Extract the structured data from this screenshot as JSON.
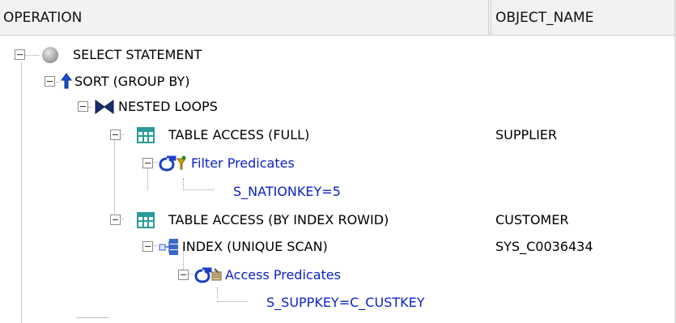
{
  "columns": {
    "operation": "OPERATION",
    "object_name": "OBJECT_NAME"
  },
  "rows": [
    {
      "label": "SELECT STATEMENT",
      "object": ""
    },
    {
      "label": "SORT (GROUP BY)",
      "object": ""
    },
    {
      "label": "NESTED LOOPS",
      "object": ""
    },
    {
      "label": "TABLE ACCESS (FULL)",
      "object": "SUPPLIER"
    },
    {
      "label": "Filter Predicates",
      "object": ""
    },
    {
      "label": "S_NATIONKEY=5",
      "object": ""
    },
    {
      "label": "TABLE ACCESS (BY INDEX ROWID)",
      "object": "CUSTOMER"
    },
    {
      "label": "INDEX (UNIQUE SCAN)",
      "object": "SYS_C0036434"
    },
    {
      "label": "Access Predicates",
      "object": ""
    },
    {
      "label": "S_SUPPKEY=C_CUSTKEY",
      "object": ""
    }
  ],
  "icons": {
    "select": "gray-circle-icon",
    "sort": "up-arrow-icon",
    "nested": "bowtie-icon",
    "table": "table-grid-icon",
    "filter": "sigma-filter-icon",
    "index": "index-icon",
    "access": "sigma-access-icon"
  },
  "colors": {
    "predicate_text": "#0b22c8",
    "table_icon": "#2a9a9a",
    "sort_icon": "#1b4fd6"
  }
}
